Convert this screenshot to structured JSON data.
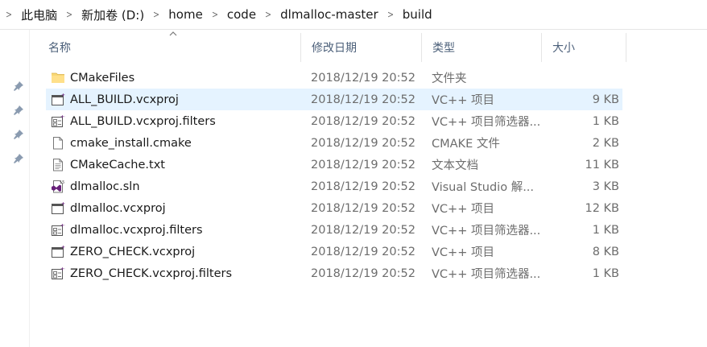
{
  "breadcrumb": [
    "此电脑",
    "新加卷 (D:)",
    "home",
    "code",
    "dlmalloc-master",
    "build"
  ],
  "columns": {
    "name": "名称",
    "date": "修改日期",
    "type": "类型",
    "size": "大小"
  },
  "files": [
    {
      "name": "CMakeFiles",
      "date": "2018/12/19 20:52",
      "type": "文件夹",
      "size": "",
      "icon": "folder-icon"
    },
    {
      "name": "ALL_BUILD.vcxproj",
      "date": "2018/12/19 20:52",
      "type": "VC++ 项目",
      "size": "9 KB",
      "icon": "vcxproj-icon"
    },
    {
      "name": "ALL_BUILD.vcxproj.filters",
      "date": "2018/12/19 20:52",
      "type": "VC++ 项目筛选器...",
      "size": "1 KB",
      "icon": "vcxproj-filters-icon"
    },
    {
      "name": "cmake_install.cmake",
      "date": "2018/12/19 20:52",
      "type": "CMAKE 文件",
      "size": "2 KB",
      "icon": "file-icon"
    },
    {
      "name": "CMakeCache.txt",
      "date": "2018/12/19 20:52",
      "type": "文本文档",
      "size": "11 KB",
      "icon": "text-file-icon"
    },
    {
      "name": "dlmalloc.sln",
      "date": "2018/12/19 20:52",
      "type": "Visual Studio 解...",
      "size": "3 KB",
      "icon": "visual-studio-solution-icon"
    },
    {
      "name": "dlmalloc.vcxproj",
      "date": "2018/12/19 20:52",
      "type": "VC++ 项目",
      "size": "12 KB",
      "icon": "vcxproj-icon"
    },
    {
      "name": "dlmalloc.vcxproj.filters",
      "date": "2018/12/19 20:52",
      "type": "VC++ 项目筛选器...",
      "size": "1 KB",
      "icon": "vcxproj-filters-icon"
    },
    {
      "name": "ZERO_CHECK.vcxproj",
      "date": "2018/12/19 20:52",
      "type": "VC++ 项目",
      "size": "8 KB",
      "icon": "vcxproj-icon"
    },
    {
      "name": "ZERO_CHECK.vcxproj.filters",
      "date": "2018/12/19 20:52",
      "type": "VC++ 项目筛选器...",
      "size": "1 KB",
      "icon": "vcxproj-filters-icon"
    }
  ],
  "selected_row": 1,
  "colors": {
    "selection": "#e5f3ff",
    "header_text": "#4c607a",
    "folder": "#f8d775",
    "vs_purple": "#68217a"
  }
}
